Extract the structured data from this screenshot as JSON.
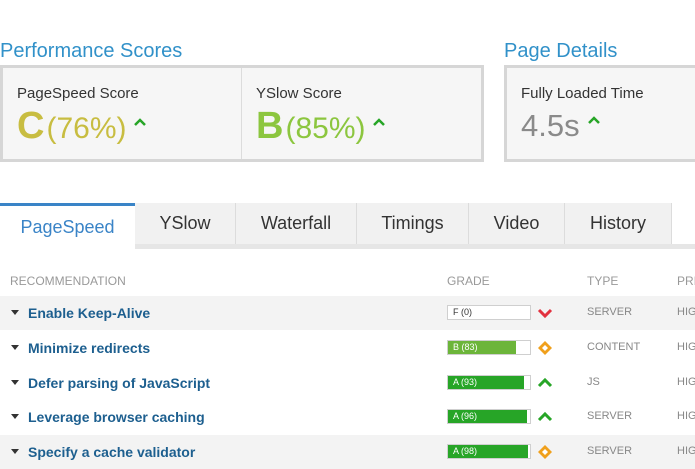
{
  "performance": {
    "title": "Performance Scores",
    "pagespeed": {
      "label": "PageSpeed Score",
      "grade": "C",
      "pct": "(76%)",
      "color": "#c8bd41"
    },
    "yslow": {
      "label": "YSlow Score",
      "grade": "B",
      "pct": "(85%)",
      "color": "#8cc63f"
    }
  },
  "page_details": {
    "title": "Page Details",
    "fully_loaded": {
      "label": "Fully Loaded Time",
      "value": "4.5s"
    }
  },
  "tabs": [
    "PageSpeed",
    "YSlow",
    "Waterfall",
    "Timings",
    "Video",
    "History"
  ],
  "table": {
    "headers": {
      "recommendation": "RECOMMENDATION",
      "grade": "GRADE",
      "type": "TYPE",
      "priority": "PRI"
    },
    "rows": [
      {
        "name": "Enable Keep-Alive",
        "grade": "F (0)",
        "fill": 0,
        "indicator": "down-chevron",
        "type": "SERVER",
        "priority": "HIG"
      },
      {
        "name": "Minimize redirects",
        "grade": "B (83)",
        "fill": 0.83,
        "indicator": "diamond",
        "type": "CONTENT",
        "priority": "HIG"
      },
      {
        "name": "Defer parsing of JavaScript",
        "grade": "A (93)",
        "fill": 0.93,
        "indicator": "up-chevron",
        "type": "JS",
        "priority": "HIG"
      },
      {
        "name": "Leverage browser caching",
        "grade": "A (96)",
        "fill": 0.96,
        "indicator": "up-chevron",
        "type": "SERVER",
        "priority": "HIG"
      },
      {
        "name": "Specify a cache validator",
        "grade": "A (98)",
        "fill": 0.98,
        "indicator": "diamond",
        "type": "SERVER",
        "priority": "HIG"
      }
    ]
  },
  "colors": {
    "accent": "#3191c9",
    "trend_up": "#27a527",
    "grade_a": "#27a527",
    "grade_b": "#6cb53a",
    "indicator_down": "#e2313f",
    "indicator_diamond": "#f0a01c"
  }
}
